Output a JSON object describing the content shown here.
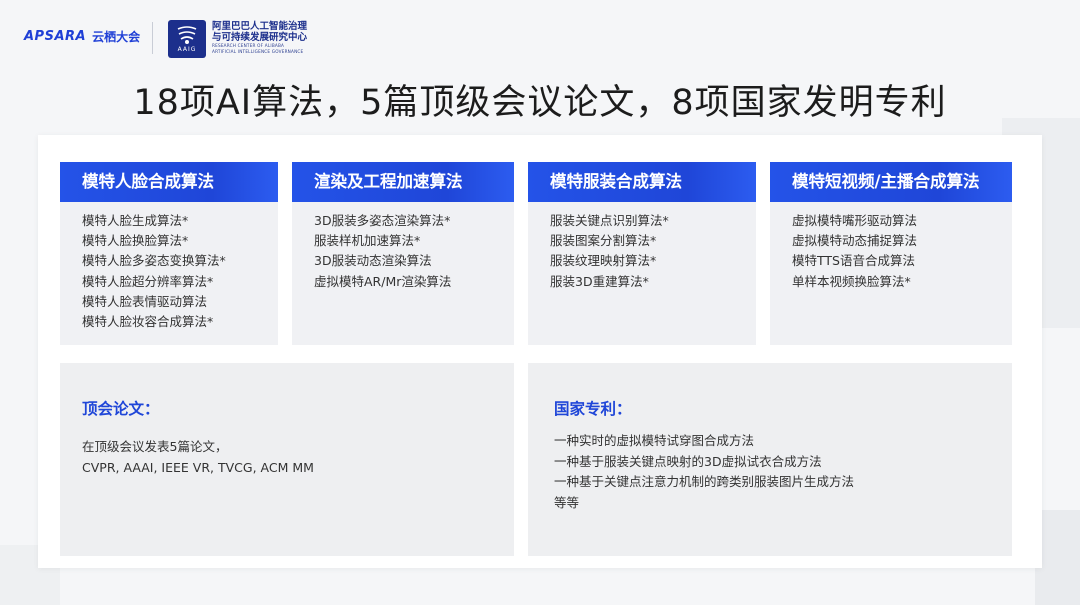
{
  "header": {
    "apsara_brand": "APSARA",
    "apsara_cn": "云栖大会",
    "aaig_abbr": "AAIG",
    "aaig_cn_line1": "阿里巴巴人工智能治理",
    "aaig_cn_line2": "与可持续发展研究中心",
    "aaig_en_line1": "RESEARCH CENTER OF ALIBABA",
    "aaig_en_line2": "ARTIFICIAL INTELLIGENCE GOVERNANCE"
  },
  "title": "18项AI算法，5篇顶级会议论文，8项国家发明专利",
  "columns": [
    {
      "heading": "模特人脸合成算法",
      "items": [
        "模特人脸生成算法*",
        "模特人脸换脸算法*",
        "模特人脸多姿态变换算法*",
        "模特人脸超分辨率算法*",
        "模特人脸表情驱动算法",
        "模特人脸妆容合成算法*"
      ]
    },
    {
      "heading": "渲染及工程加速算法",
      "items": [
        "3D服装多姿态渲染算法*",
        "服装样机加速算法*",
        "3D服装动态渲染算法",
        "虚拟模特AR/Mr渲染算法"
      ]
    },
    {
      "heading": "模特服装合成算法",
      "items": [
        "服装关键点识别算法*",
        "服装图案分割算法*",
        "服装纹理映射算法*",
        "服装3D重建算法*"
      ]
    },
    {
      "heading": "模特短视频/主播合成算法",
      "items": [
        "虚拟模特嘴形驱动算法",
        "虚拟模特动态捕捉算法",
        "模特TTS语音合成算法",
        "单样本视频换脸算法*"
      ]
    }
  ],
  "papers": {
    "heading": "顶会论文：",
    "lines": [
      "在顶级会议发表5篇论文，",
      "CVPR, AAAI, IEEE VR, TVCG, ACM MM"
    ]
  },
  "patents": {
    "heading": "国家专利：",
    "lines": [
      "一种实时的虚拟模特试穿图合成方法",
      "一种基于服装关键点映射的3D虚拟试衣合成方法",
      "一种基于关键点注意力机制的跨类别服装图片生成方法",
      "等等"
    ]
  },
  "colors": {
    "accent": "#1f46d8",
    "panel": "#f0f1f4",
    "background": "#f5f6f8"
  }
}
